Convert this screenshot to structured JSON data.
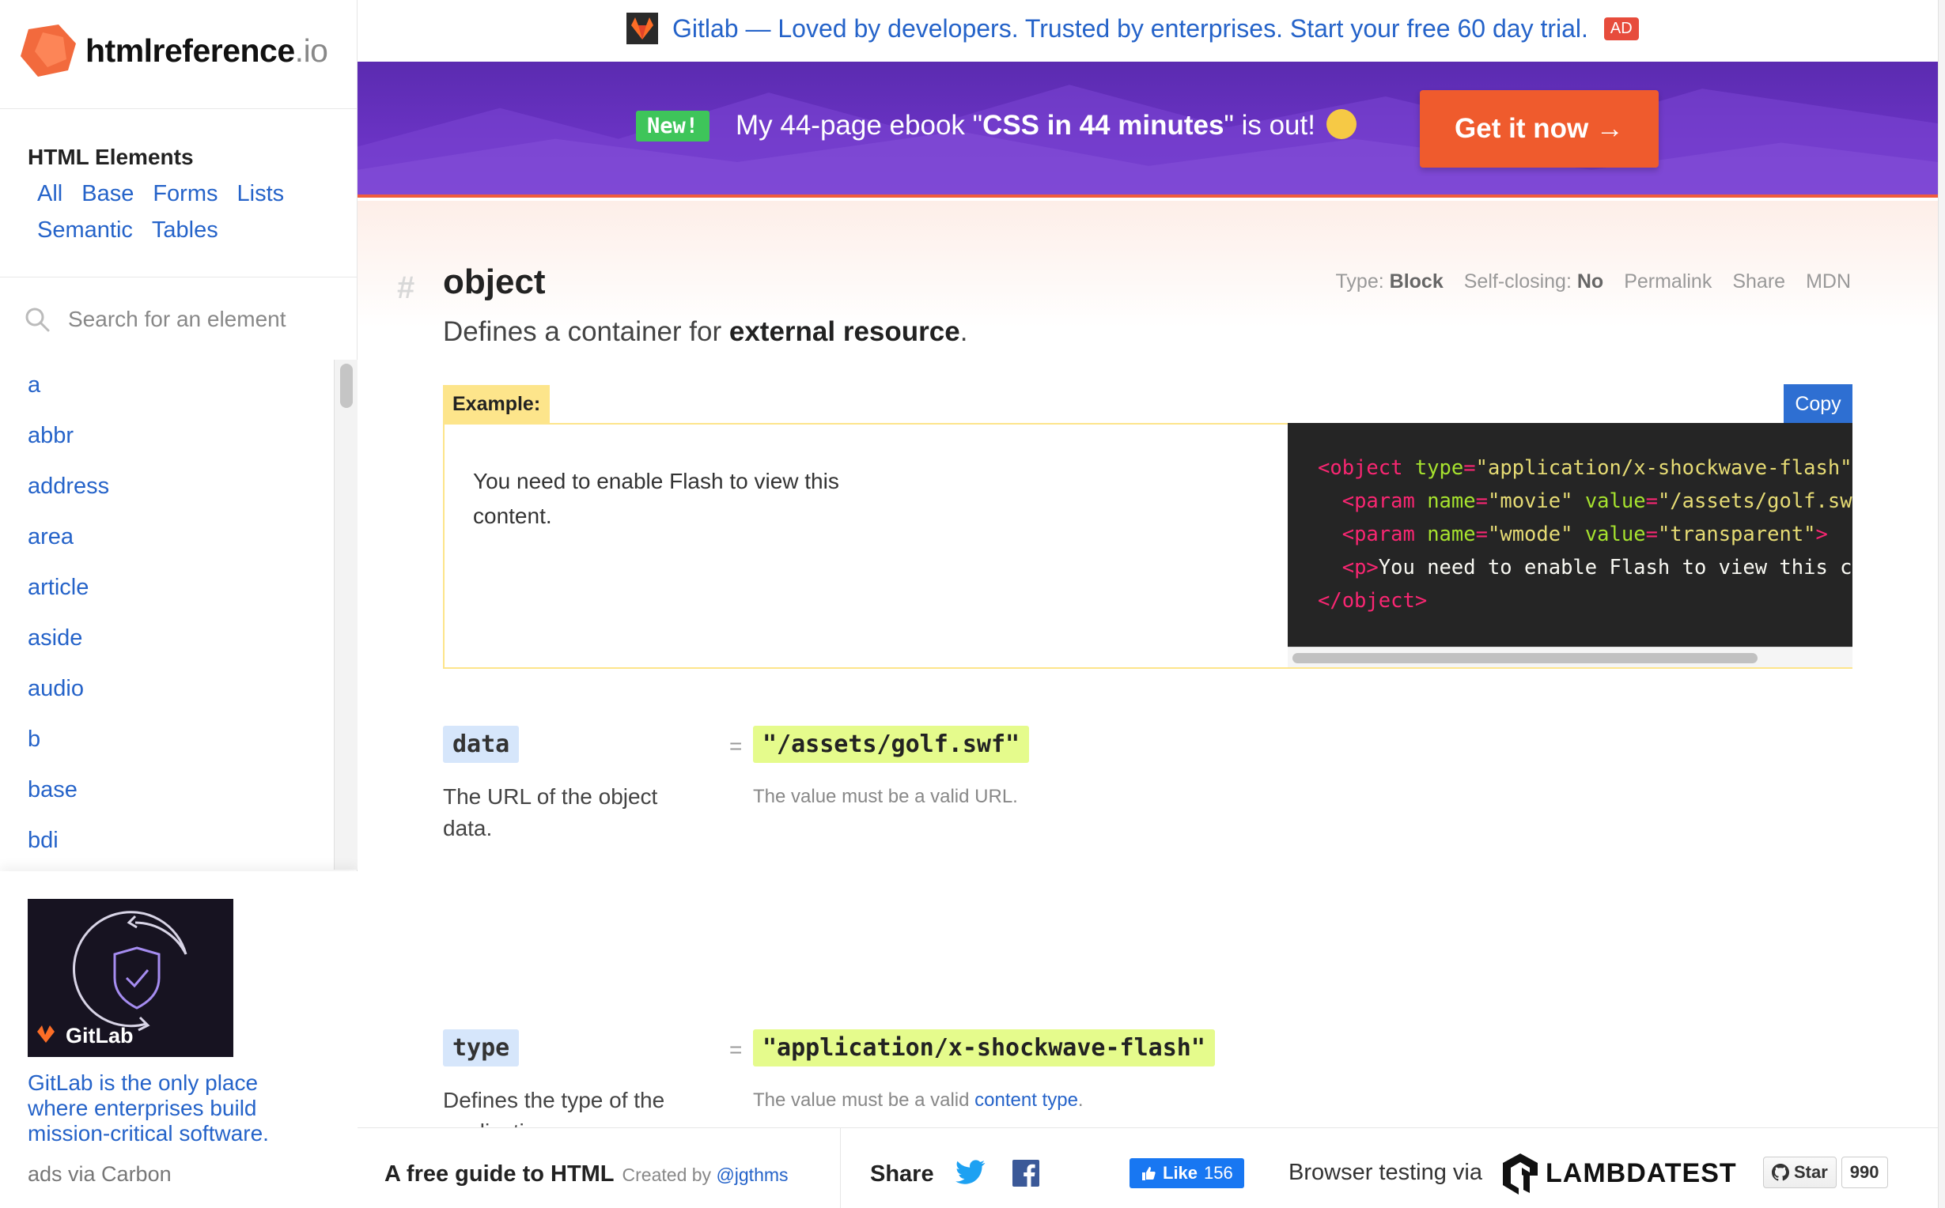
{
  "logo": {
    "name": "htmlreference",
    "tld": ".io"
  },
  "categories": {
    "title": "HTML Elements",
    "links": [
      "All",
      "Base",
      "Forms",
      "Lists",
      "Semantic",
      "Tables"
    ]
  },
  "search": {
    "placeholder": "Search for an element"
  },
  "elements": [
    "a",
    "abbr",
    "address",
    "area",
    "article",
    "aside",
    "audio",
    "b",
    "base",
    "bdi"
  ],
  "sidebar_ad": {
    "brand": "GitLab",
    "text": "GitLab is the only place where enterprises build mission-critical software.",
    "via": "ads via Carbon"
  },
  "top_ad": {
    "text": "Gitlab —  Loved by developers. Trusted by enterprises. Start your free 60 day trial.",
    "badge": "AD"
  },
  "promo": {
    "new_badge": "New!",
    "msg_prefix": "My 44-page ebook \"",
    "msg_bold": "CSS in 44 minutes",
    "msg_suffix": "\" is out!",
    "cta": "Get it now →"
  },
  "element": {
    "hash": "#",
    "name": "object",
    "type_label": "Type:",
    "type_value": "Block",
    "selfclosing_label": "Self-closing:",
    "selfclosing_value": "No",
    "permalink": "Permalink",
    "share": "Share",
    "mdn": "MDN",
    "desc_prefix": "Defines a container for ",
    "desc_bold": "external resource",
    "desc_suffix": "."
  },
  "example": {
    "label": "Example:",
    "copy": "Copy",
    "rendered_text": "You need to enable Flash to view this content."
  },
  "attributes": [
    {
      "name": "data",
      "eq": "=",
      "value": "\"/assets/golf.swf\"",
      "desc": "The URL of the object data.",
      "note_prefix": "The value must be a valid URL.",
      "note_link": "",
      "note_suffix": ""
    },
    {
      "name": "type",
      "eq": "=",
      "value": "\"application/x-shockwave-flash\"",
      "desc": "Defines the type of the application",
      "note_prefix": "The value must be a valid ",
      "note_link": "content type",
      "note_suffix": "."
    }
  ],
  "footer": {
    "guide": "A free guide to HTML",
    "created_by": "Created by",
    "author": "@jgthms",
    "share": "Share",
    "like": "Like",
    "like_count": "156",
    "browser_testing": "Browser testing via",
    "lambdatest": "LAMBDATEST",
    "star": "Star",
    "star_count": "990"
  },
  "colors": {
    "link": "#2563c9",
    "promo_bg": "#6a33c4",
    "cta": "#ef5b2d",
    "attr_name_bg": "#d6e6fb",
    "attr_value_bg": "#e5fb8c"
  }
}
